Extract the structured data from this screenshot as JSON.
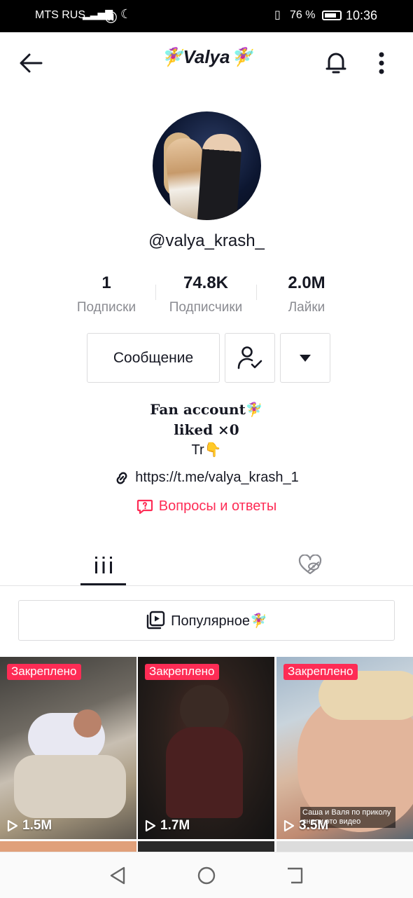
{
  "status_bar": {
    "carrier": "MTS RUS",
    "battery": "76 %",
    "time": "10:36"
  },
  "header": {
    "title": "🧚‍♀️Valya🧚‍♀️",
    "back_icon": "arrow-left-icon",
    "bell_icon": "bell-icon",
    "more_icon": "more-vertical-icon"
  },
  "profile": {
    "handle": "@valya_krash_",
    "stats": [
      {
        "value": "1",
        "label": "Подписки"
      },
      {
        "value": "74.8K",
        "label": "Подписчики"
      },
      {
        "value": "2.0M",
        "label": "Лайки"
      }
    ],
    "message_button": "Сообщение",
    "bio_line1": "Fan account🧚‍♀️",
    "bio_line2": "liked ×0",
    "bio_line3": "Tr👇",
    "link": "https://t.me/valya_krash_1",
    "qa": "Вопросы и ответы"
  },
  "popular": {
    "label": "Популярное🧚‍♀️"
  },
  "videos": [
    {
      "pinned": "Закреплено",
      "views": "1.5M"
    },
    {
      "pinned": "Закреплено",
      "views": "1.7M"
    },
    {
      "pinned": "Закреплено",
      "views": "3.5M",
      "caption": "Саша и Валя по приколу сняли это видео"
    }
  ],
  "colors": {
    "accent": "#fe2c55",
    "text": "#161823",
    "secondary": "#8a8b91"
  }
}
